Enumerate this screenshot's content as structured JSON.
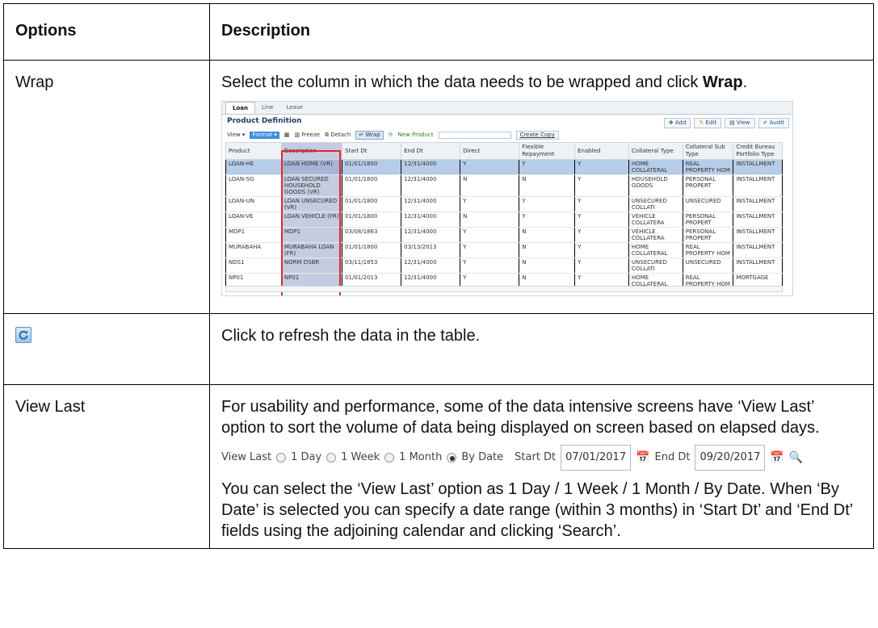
{
  "table": {
    "headers": [
      "Options",
      "Description"
    ],
    "rows": [
      {
        "option": "Wrap",
        "desc_pre": "Select the column in which the data needs to be wrapped and click ",
        "desc_bold": "Wrap",
        "desc_post": "."
      },
      {
        "option_icon": "refresh-icon",
        "desc": "Click to refresh the data in the table."
      },
      {
        "option": "View Last",
        "desc1": "For usability and performance, some of the data intensive screens have ‘View Last’ option to sort the volume of data being displayed on screen based on elapsed days.",
        "desc2": "You can select the ‘View Last’ option as 1 Day / 1 Week / 1 Month / By Date. When ‘By Date’ is selected you can specify a date range (within 3 months) in ‘Start Dt’ and ‘End Dt’ fields using the adjoining calendar and clicking ‘Search’."
      }
    ]
  },
  "shot1": {
    "tabs": [
      "Loan",
      "Line",
      "Lease"
    ],
    "title": "Product Definition",
    "actions": [
      "Add",
      "Edit",
      "View",
      "Audit"
    ],
    "toolbar": {
      "view": "View ▾",
      "format": "Format ▾",
      "freeze": "Freeze",
      "detach": "Detach",
      "wrap": "Wrap",
      "new_product": "New Product",
      "create_copy": "Create Copy"
    },
    "columns": [
      "Product",
      "Description",
      "Start Dt",
      "End Dt",
      "Direct",
      "Flexible Repayment",
      "Enabled",
      "Collateral Type",
      "Collateral Sub Type",
      "Credit Bureau Portfolio Type"
    ],
    "rows": [
      [
        "LOAN-HE",
        "LOAN HOME (VR)",
        "01/01/1800",
        "12/31/4000",
        "Y",
        "Y",
        "Y",
        "HOME COLLATERAL",
        "REAL PROPERTY HOM",
        "INSTALLMENT"
      ],
      [
        "LOAN-SG",
        "LOAN SECURED HOUSEHOLD GOODS (VR)",
        "01/01/1800",
        "12/31/4000",
        "N",
        "N",
        "Y",
        "HOUSEHOLD GOODS",
        "PERSONAL PROPERT",
        "INSTALLMENT"
      ],
      [
        "LOAN-UN",
        "LOAN UNSECURED (VR)",
        "01/01/1800",
        "12/31/4000",
        "Y",
        "Y",
        "Y",
        "UNSECURED COLLATI",
        "UNSECURED",
        "INSTALLMENT"
      ],
      [
        "LOAN-VE",
        "LOAN VEHICLE (FR)",
        "01/01/1800",
        "12/31/4000",
        "N",
        "Y",
        "Y",
        "VEHICLE COLLATERA",
        "PERSONAL PROPERT",
        "INSTALLMENT"
      ],
      [
        "MDP1",
        "MDP1",
        "03/08/1863",
        "12/31/4000",
        "Y",
        "N",
        "Y",
        "VEHICLE COLLATERA",
        "PERSONAL PROPERT",
        "INSTALLMENT"
      ],
      [
        "MURABAHA",
        "MURABAHA LOAN (FR)",
        "01/01/1800",
        "03/13/2013",
        "Y",
        "N",
        "Y",
        "HOME COLLATERAL",
        "REAL PROPERTY HOM",
        "INSTALLMENT"
      ],
      [
        "NDS1",
        "NORM DSBR",
        "03/11/1853",
        "12/31/4000",
        "Y",
        "N",
        "Y",
        "UNSECURED COLLATI",
        "UNSECURED",
        "INSTALLMENT"
      ],
      [
        "NP01",
        "NP01",
        "01/01/2013",
        "12/31/4000",
        "Y",
        "N",
        "Y",
        "HOME COLLATERAL",
        "REAL PROPERTY HOM",
        "MORTGAGE"
      ]
    ]
  },
  "shot2": {
    "label": "View Last",
    "opt1": "1 Day",
    "opt2": "1 Week",
    "opt3": "1 Month",
    "opt4": "By Date",
    "start_label": "Start Dt",
    "start_value": "07/01/2017",
    "end_label": "End Dt",
    "end_value": "09/20/2017"
  }
}
